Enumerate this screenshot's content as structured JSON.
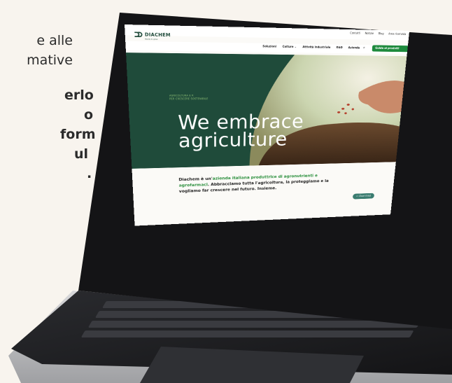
{
  "side_text": {
    "normal_lines": [
      "e alle",
      "mative"
    ],
    "bold_lines": [
      "erlo",
      "o",
      "form",
      "ul",
      "."
    ]
  },
  "site": {
    "logo_name": "DIACHEM",
    "logo_tagline": "Ready to grow",
    "top_links": [
      "Contatti",
      "Notizie",
      "Blog",
      "Area riservata"
    ],
    "nav_items": [
      "Soluzioni",
      "Colture ⌄",
      "Attività industriale",
      "R&D",
      "Azienda"
    ],
    "search_icon": "search-icon",
    "cta_label": "Guida ai prodotti",
    "hero_label_lines": [
      "AGRICOLTURA E P.",
      "PER CRESCERE SOSTENIBILE"
    ],
    "headline_lines": [
      "We embrace",
      "agriculture"
    ],
    "intro_prefix": "Diachem è un'",
    "intro_highlight": "azienda italiana produttrice di agronutrienti e agrofarmaci",
    "intro_rest": ". Abbracciamo tutta l'agricoltura, la proteggiamo e la vogliamo far crescere nel futuro. Insieme.",
    "download_label": "Download"
  },
  "colors": {
    "background": "#f8f4ee",
    "brand_green": "#1f4b3a",
    "accent_green": "#1d8a3c",
    "laptop_body": "#1c1d20"
  }
}
